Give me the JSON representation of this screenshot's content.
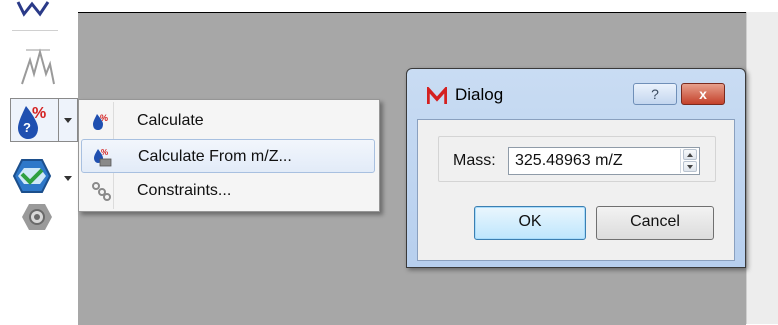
{
  "toolbar": {
    "icons": [
      "structure-icon",
      "spectrum-icon",
      "calculate-icon",
      "constraints-dropdown-icon",
      "settings-icon"
    ]
  },
  "context_menu": {
    "items": [
      {
        "label": "Calculate",
        "icon": "calculate-icon",
        "highlighted": false
      },
      {
        "label": "Calculate From m/Z...",
        "icon": "calculate-from-mz-icon",
        "highlighted": true
      },
      {
        "label": "Constraints...",
        "icon": "constraints-icon",
        "highlighted": false
      }
    ]
  },
  "dialog": {
    "title": "Dialog",
    "help_label": "?",
    "close_label": "x",
    "mass_label": "Mass:",
    "mass_value": "325.48963 m/Z",
    "ok_label": "OK",
    "cancel_label": "Cancel"
  },
  "colors": {
    "canvas_bg": "#a7a7a7",
    "dialog_frame": "#b7cfee",
    "close_button": "#c4412b",
    "accent_blue": "#3c7fb1"
  }
}
